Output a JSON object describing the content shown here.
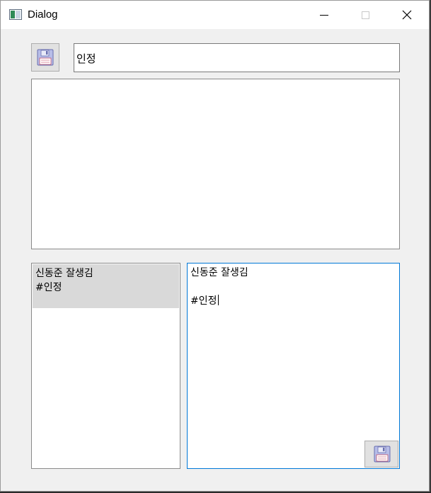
{
  "window": {
    "title": "Dialog"
  },
  "icons": {
    "app": "app-window-icon",
    "minimize": "minimize-icon",
    "maximize": "maximize-icon",
    "close": "close-icon",
    "save": "floppy-disk-icon"
  },
  "tag_input": {
    "value": "인정"
  },
  "content_area": {
    "value": ""
  },
  "list": {
    "items": [
      {
        "text": "신동준 잘생김\n#인정"
      }
    ]
  },
  "editor": {
    "line1": "신동준 잘생김",
    "line2": "",
    "line3": "#인정"
  },
  "colors": {
    "focus_border": "#0078d7",
    "selected_item": "#d9d9d9",
    "dialog_bg": "#f0f0f0"
  }
}
